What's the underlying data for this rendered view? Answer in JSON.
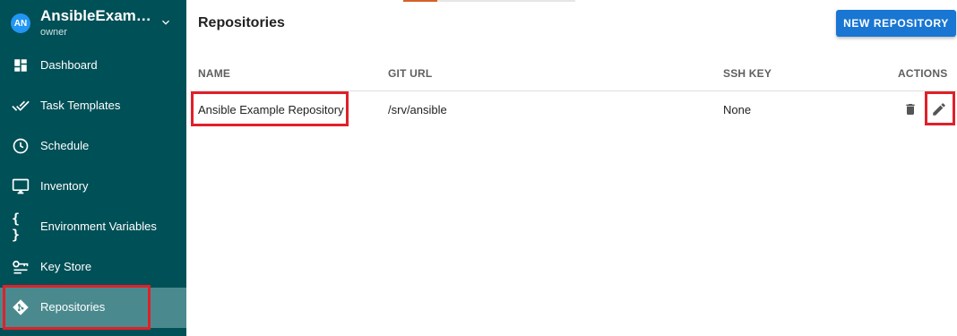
{
  "project": {
    "avatar_initials": "AN",
    "name": "AnsibleExampl...",
    "role": "owner",
    "icon": "chevron-down-icon"
  },
  "sidebar": {
    "items": [
      {
        "label": "Dashboard",
        "icon": "dashboard-icon"
      },
      {
        "label": "Task Templates",
        "icon": "double-check-icon"
      },
      {
        "label": "Schedule",
        "icon": "clock-icon"
      },
      {
        "label": "Inventory",
        "icon": "monitor-icon"
      },
      {
        "label": "Environment Variables",
        "icon": "braces-icon"
      },
      {
        "label": "Key Store",
        "icon": "key-icon"
      },
      {
        "label": "Repositories",
        "icon": "git-icon",
        "active": true
      }
    ]
  },
  "main": {
    "title": "Repositories",
    "new_button": "NEW REPOSITORY",
    "table": {
      "headers": [
        "NAME",
        "GIT URL",
        "SSH KEY",
        "ACTIONS"
      ],
      "rows": [
        {
          "name": "Ansible Example Repository",
          "git_url": "/srv/ansible",
          "ssh_key": "None"
        }
      ]
    }
  },
  "colors": {
    "sidebar_bg": "#005057",
    "sidebar_active": "#4a8a8e",
    "primary_button": "#1976d2",
    "highlight": "#e0202a"
  }
}
